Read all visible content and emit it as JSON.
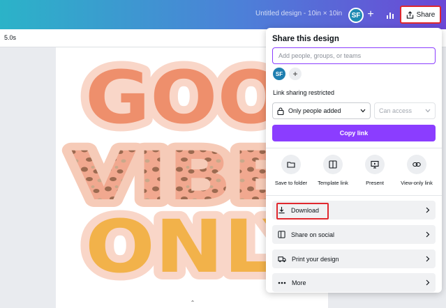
{
  "header": {
    "doc_title": "Untitled design - 10in × 10in",
    "avatar_initials": "SF",
    "share_label": "Share"
  },
  "subbar": {
    "duration": "5.0s"
  },
  "canvas": {
    "art_words": [
      "GOOD",
      "VIBES",
      "ONLY"
    ]
  },
  "share_panel": {
    "title": "Share this design",
    "people_placeholder": "Add people, groups, or teams",
    "avatar_initials": "SF",
    "link_sharing_label": "Link sharing restricted",
    "access_value": "Only people added",
    "permission_value": "Can access",
    "copy_link_label": "Copy link",
    "quick_actions": [
      {
        "label": "Save to folder",
        "icon": "folder-icon"
      },
      {
        "label": "Template link",
        "icon": "template-icon"
      },
      {
        "label": "Present",
        "icon": "present-icon"
      },
      {
        "label": "View-only link",
        "icon": "link-icon"
      }
    ],
    "options": [
      {
        "label": "Download",
        "icon": "download-icon"
      },
      {
        "label": "Share on social",
        "icon": "social-icon"
      },
      {
        "label": "Print your design",
        "icon": "truck-icon"
      },
      {
        "label": "More",
        "icon": "more-icon"
      }
    ]
  },
  "colors": {
    "accent": "#8b3dff",
    "highlight": "#e0282e",
    "art_orange": "#ee8f6c",
    "art_yellow": "#f2b24a",
    "art_outline": "#f9d6c8"
  }
}
